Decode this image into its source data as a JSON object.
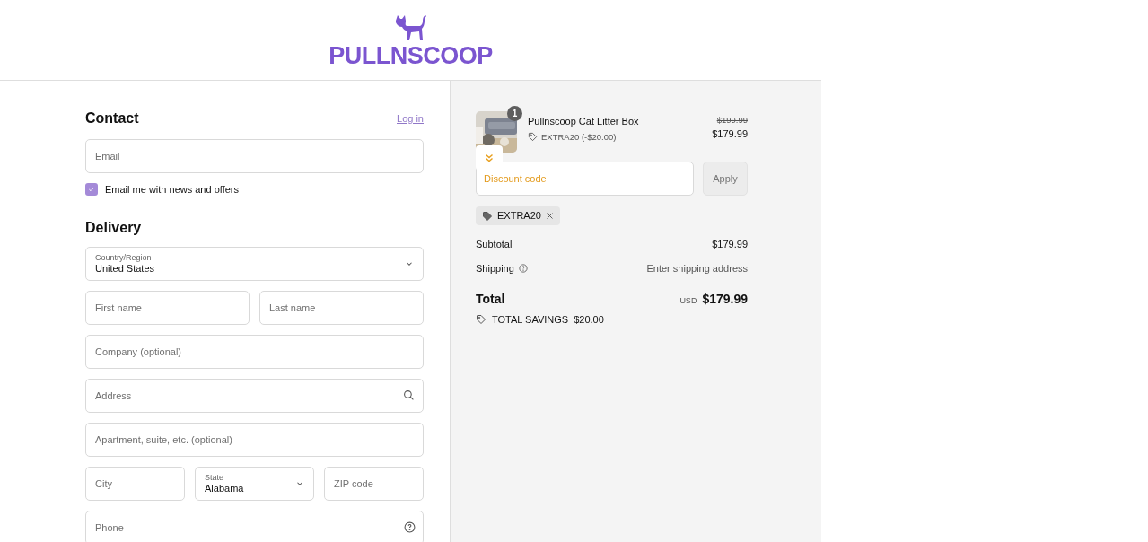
{
  "header": {
    "logo": "PULLNSCOOP"
  },
  "contact": {
    "heading": "Contact",
    "login_link": "Log in",
    "email": {
      "placeholder": "Email"
    },
    "newsletter": {
      "label": "Email me with news and offers",
      "checked": true
    }
  },
  "delivery": {
    "heading": "Delivery",
    "rows": [
      [
        {
          "kind": "select",
          "label": "Country/Region",
          "value": "United States"
        }
      ],
      [
        {
          "kind": "input",
          "placeholder": "First name"
        },
        {
          "kind": "input",
          "placeholder": "Last name"
        }
      ],
      [
        {
          "kind": "input",
          "placeholder": "Company (optional)"
        }
      ],
      [
        {
          "kind": "search_input",
          "placeholder": "Address"
        }
      ],
      [
        {
          "kind": "input",
          "placeholder": "Apartment, suite, etc. (optional)"
        }
      ],
      [
        {
          "kind": "input",
          "placeholder": "City"
        },
        {
          "kind": "select",
          "label": "State",
          "value": "Alabama"
        },
        {
          "kind": "input",
          "placeholder": "ZIP code"
        }
      ],
      [
        {
          "kind": "help_input",
          "placeholder": "Phone"
        }
      ]
    ]
  },
  "summary": {
    "product": {
      "quantity": "1",
      "name": "Pullnscoop Cat Litter Box",
      "discount": "EXTRA20 (-$20.00)",
      "compare_price": "$199.99",
      "price": "$179.99"
    },
    "discount_field": {
      "placeholder": "Discount code"
    },
    "apply_button": "Apply",
    "applied_codes": [
      "EXTRA20"
    ],
    "lines": [
      {
        "kind": "plain",
        "label": "Subtotal",
        "value": "$179.99"
      },
      {
        "kind": "help",
        "label": "Shipping",
        "value": "Enter shipping address"
      }
    ],
    "total": {
      "label": "Total",
      "currency": "USD",
      "amount": "$179.99"
    },
    "savings": {
      "label": "TOTAL SAVINGS",
      "amount": "$20.00"
    }
  }
}
